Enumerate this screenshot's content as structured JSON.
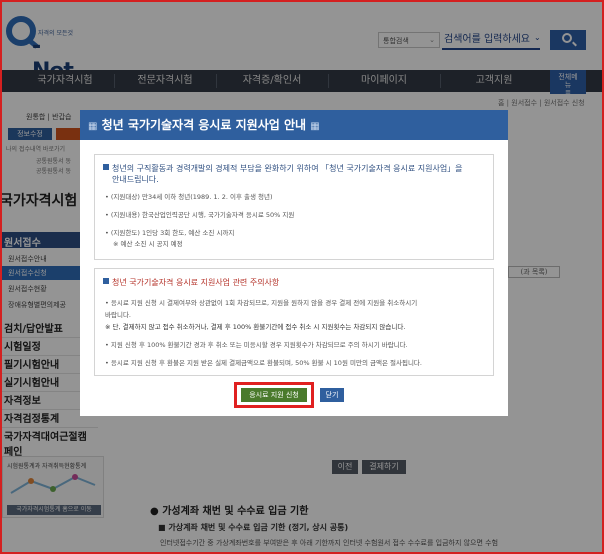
{
  "header": {
    "logo_text": "-Net",
    "logo_sub": "자격의 모든것",
    "search_scope": "통합검색",
    "search_placeholder": "검색어를 입력하세요"
  },
  "gnb": [
    "국가자격시험",
    "전문자격시험",
    "자격증/확인서",
    "마이페이지",
    "고객지원"
  ],
  "gnb_all": [
    "전체메",
    "뉴"
  ],
  "breadcrumb": "홈 | 원서접수 | 원서접수 신청",
  "left": {
    "top_text": "원통합 | 반갑습",
    "btn_info": "정보수정",
    "small1": "나의 접수내역 바로가기",
    "small2": "공통원통서 동",
    "small3": "공통원통서 동",
    "title": "국가자격시험",
    "section": "원서접수",
    "subs": [
      "원서접수안내",
      "원서접수신청",
      "원서접수현황",
      "장애유형별편의제공"
    ],
    "menus": [
      "검치/답안발표",
      "시험일정",
      "필기시험안내",
      "실기시험안내",
      "자격정보",
      "자격검정통계",
      "국가자격대여근절캠페인"
    ],
    "stat_title": "시험원통계과 자격취득현황통계",
    "stat_btn": "국가자격시험통계 홈으로 이동"
  },
  "right": {
    "ghost1": "",
    "ghost2": "(과 목록)"
  },
  "background": {
    "btn_prev": "이전",
    "btn_next": "결제하기",
    "heading": "가성계좌 채번 및 수수료 입금 기한",
    "sub_heading": "가상계좌 채번 및 수수료 입금 기한 (정기, 상시 공통)",
    "text": "인터넷접수기간 중 가상계좌번호를 부여받은 후 아래 기한까지 인터넷 수험원서 접수 수수료를 입금하지 않으면 수험"
  },
  "modal": {
    "title": "청년 국가기술자격 응시료 지원사업 안내",
    "box1": {
      "heading_lines": [
        "청년의 구직활동과 경력개발의 경제적 부담을 완화하기 위하여 「청년 국가기술자격 응시료 지원사업」을",
        "안내드립니다."
      ],
      "items": [
        "• (지원대상) 만34세 이하 청년(1989. 1. 2. 이후 출생 청년)",
        "• (지원내용) 한국산업인력공단 시행, 국가기술자격 응시료 50% 지원",
        "• (지원한도) 1인당 3회 한도, 예산 소진 시까지",
        "※ 예산 소진 시 공지 예정"
      ]
    },
    "box2": {
      "heading": "청년 국가기술자격 응시료 지원사업 관련 주의사항",
      "items": [
        "• 응시료 지원 신청 시 결제여부와 상관없이 1회 차감되므로, 지원을 원하지 않을 경우 결제 전에 지원을 취소하시기",
        "  바랍니다.",
        "  ※ 단, 결제하지 않고 접수 취소하거나, 결제 후 100% 환불기간에 접수 취소 시 지원횟수는 차감되지 않습니다.",
        "• 지원 신청 후 100% 환불기간 경과 후 취소 또는 미응시할 경우 지원횟수가 차감되므로 주의 하시기 바랍니다.",
        "• 응시료 지원 신청 후 환불은 지원 받은 실제 결제금액으로 환불되며, 50% 환불 시 10원 미만의 금액은 절사됩니다."
      ]
    },
    "btn_apply": "응시료 지원 신청",
    "btn_close": "닫기"
  }
}
